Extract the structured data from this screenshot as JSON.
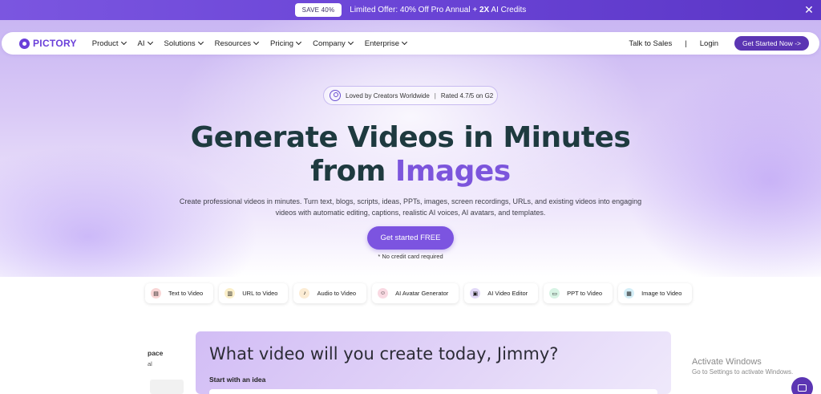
{
  "promo": {
    "save": "SAVE 40%",
    "text": "Limited Offer: 40% Off Pro Annual + ",
    "bold": "2X",
    "text2": " AI Credits",
    "close": "✕"
  },
  "nav": {
    "logo": "PICTORY",
    "items": [
      "Product",
      "AI",
      "Solutions",
      "Resources",
      "Pricing",
      "Company",
      "Enterprise"
    ],
    "talk": "Talk to Sales",
    "sep": "|",
    "login": "Login",
    "cta": "Get Started Now ->"
  },
  "hero": {
    "rated_a": "Loved by Creators Worldwide",
    "rated_sep": "|",
    "rated_b": "Rated 4.7/5 on G2",
    "title_line1": "Generate Videos in Minutes",
    "title_from": "from",
    "title_accent": "Images",
    "subtitle": "Create professional videos in minutes. Turn text, blogs, scripts, ideas, PPTs, images, screen recordings, URLs, and existing videos into engaging videos with automatic editing, captions, realistic AI voices, AI avatars, and templates.",
    "cta": "Get started FREE",
    "note": "* No credit card required"
  },
  "chips": [
    {
      "label": "Text to Video",
      "icon": "text-doc-icon",
      "color": "#f9d6d6",
      "glyph": "▤"
    },
    {
      "label": "URL to Video",
      "icon": "link-doc-icon",
      "color": "#fbefc9",
      "glyph": "▥"
    },
    {
      "label": "Audio to Video",
      "icon": "microphone-icon",
      "color": "#fcecd4",
      "glyph": "♪"
    },
    {
      "label": "AI Avatar Generator",
      "icon": "avatar-icon",
      "color": "#f9d9e2",
      "glyph": "☺"
    },
    {
      "label": "AI Video Editor",
      "icon": "video-editor-icon",
      "color": "#e2d9f8",
      "glyph": "▣"
    },
    {
      "label": "PPT to Video",
      "icon": "presentation-icon",
      "color": "#d7f3e4",
      "glyph": "▭"
    },
    {
      "label": "Image to Video",
      "icon": "image-icon",
      "color": "#d4eef7",
      "glyph": "▦"
    }
  ],
  "workspace": {
    "side_title": "pace",
    "side_sub": "al",
    "title": "What video will you create today, Jimmy?",
    "start": "Start with an idea"
  },
  "watermark": {
    "line1": "Activate Windows",
    "line2": "Go to Settings to activate Windows."
  }
}
